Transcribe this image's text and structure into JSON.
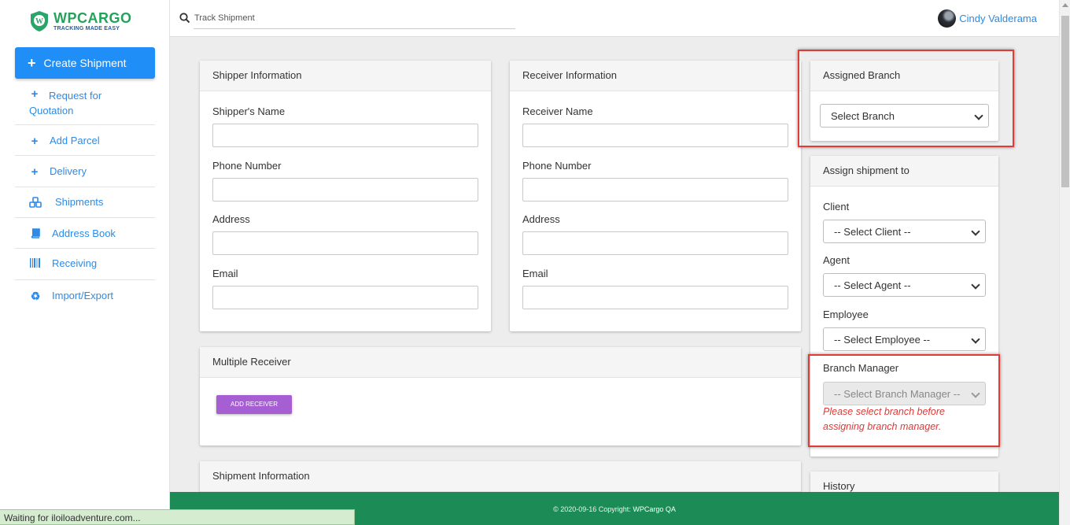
{
  "brand": {
    "name": "WPCARGO",
    "tagline": "TRACKING MADE EASY"
  },
  "sidebar": {
    "create_label": "Create Shipment",
    "items": [
      {
        "icon": "plus-icon",
        "label_line1": "Request for",
        "label_line2": "Quotation"
      },
      {
        "icon": "plus-icon",
        "label_line1": "Add Parcel"
      },
      {
        "icon": "plus-icon",
        "label_line1": "Delivery"
      },
      {
        "icon": "cubes-icon",
        "label_line1": "Shipments"
      },
      {
        "icon": "book-icon",
        "label_line1": "Address Book"
      },
      {
        "icon": "barcode-icon",
        "label_line1": "Receiving"
      },
      {
        "icon": "recycle-icon",
        "label_line1": "Import/Export"
      }
    ]
  },
  "topbar": {
    "search_placeholder": "Track Shipment",
    "user_name": "Cindy Valderama"
  },
  "shipper": {
    "title": "Shipper Information",
    "name_label": "Shipper's Name",
    "phone_label": "Phone Number",
    "address_label": "Address",
    "email_label": "Email"
  },
  "receiver": {
    "title": "Receiver Information",
    "name_label": "Receiver Name",
    "phone_label": "Phone Number",
    "address_label": "Address",
    "email_label": "Email"
  },
  "multiple_receiver": {
    "title": "Multiple Receiver",
    "button_label": "ADD RECEIVER"
  },
  "shipment_info": {
    "title": "Shipment Information"
  },
  "assigned_branch": {
    "title": "Assigned Branch",
    "select_value": "Select Branch"
  },
  "assign_to": {
    "title": "Assign shipment to",
    "client_label": "Client",
    "client_value": "-- Select Client --",
    "agent_label": "Agent",
    "agent_value": "-- Select Agent --",
    "employee_label": "Employee",
    "employee_value": "-- Select Employee --",
    "manager_label": "Branch Manager",
    "manager_value": "-- Select Branch Manager --",
    "manager_error_line1": "Please select branch before",
    "manager_error_line2": "assigning branch manager."
  },
  "history": {
    "title": "History"
  },
  "footer": {
    "text": "© 2020-09-16 Copyright:",
    "site": "WPCargo QA"
  },
  "status_bar": {
    "text": "Waiting for iloiloadventure.com..."
  },
  "colors": {
    "primary": "#1f8ef7",
    "link": "#2d8ae6",
    "footer": "#1d8b55",
    "button_purple": "#a55fd3",
    "error": "#e03838",
    "highlight": "#e23b35"
  }
}
